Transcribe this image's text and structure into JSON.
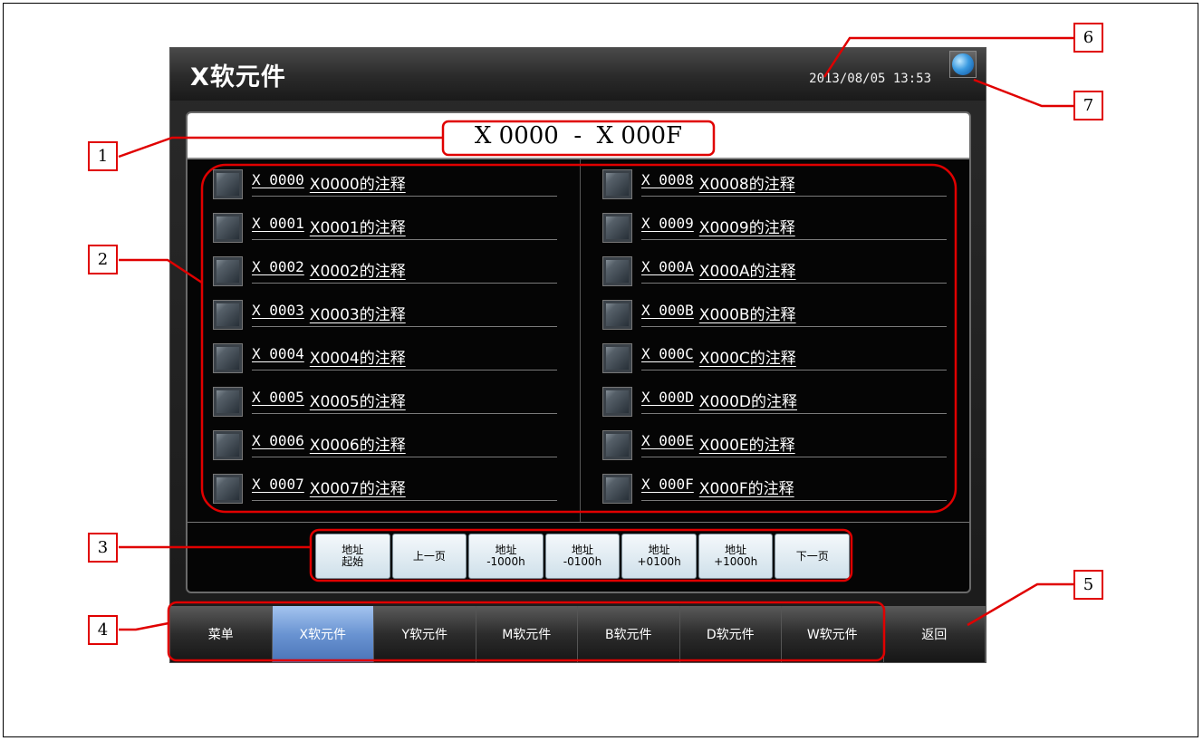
{
  "header": {
    "title": "X软元件",
    "datetime": "2013/08/05 13:53",
    "globe_icon": "globe-icon"
  },
  "range": {
    "label": "X 0000  -  X 000F"
  },
  "devices": [
    {
      "address": "X 0000",
      "comment": "X0000的注释"
    },
    {
      "address": "X 0001",
      "comment": "X0001的注释"
    },
    {
      "address": "X 0002",
      "comment": "X0002的注释"
    },
    {
      "address": "X 0003",
      "comment": "X0003的注释"
    },
    {
      "address": "X 0004",
      "comment": "X0004的注释"
    },
    {
      "address": "X 0005",
      "comment": "X0005的注释"
    },
    {
      "address": "X 0006",
      "comment": "X0006的注释"
    },
    {
      "address": "X 0007",
      "comment": "X0007的注释"
    },
    {
      "address": "X 0008",
      "comment": "X0008的注释"
    },
    {
      "address": "X 0009",
      "comment": "X0009的注释"
    },
    {
      "address": "X 000A",
      "comment": "X000A的注释"
    },
    {
      "address": "X 000B",
      "comment": "X000B的注释"
    },
    {
      "address": "X 000C",
      "comment": "X000C的注释"
    },
    {
      "address": "X 000D",
      "comment": "X000D的注释"
    },
    {
      "address": "X 000E",
      "comment": "X000E的注释"
    },
    {
      "address": "X 000F",
      "comment": "X000F的注释"
    }
  ],
  "nav_buttons": [
    {
      "label": "地址\n起始"
    },
    {
      "label": "上一页"
    },
    {
      "label": "地址\n-1000h"
    },
    {
      "label": "地址\n-0100h"
    },
    {
      "label": "地址\n+0100h"
    },
    {
      "label": "地址\n+1000h"
    },
    {
      "label": "下一页"
    }
  ],
  "footer_tabs": [
    {
      "label": "菜单",
      "active": false
    },
    {
      "label": "X软元件",
      "active": true
    },
    {
      "label": "Y软元件",
      "active": false
    },
    {
      "label": "M软元件",
      "active": false
    },
    {
      "label": "B软元件",
      "active": false
    },
    {
      "label": "D软元件",
      "active": false
    },
    {
      "label": "W软元件",
      "active": false
    },
    {
      "label": "返回",
      "active": false
    }
  ],
  "callouts": [
    "1",
    "2",
    "3",
    "4",
    "5",
    "6",
    "7"
  ],
  "colors": {
    "annotation": "#e00000",
    "active_tab": "#6a94d2",
    "panel_bg": "#050505"
  }
}
